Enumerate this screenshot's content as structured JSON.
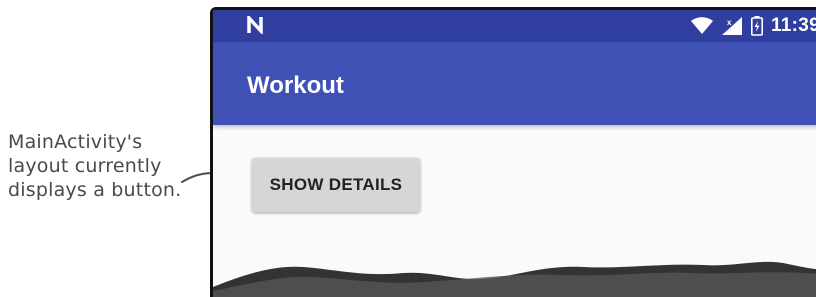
{
  "annotation": {
    "lines": [
      "MainActivity's",
      "layout currently",
      "displays a button."
    ]
  },
  "statusbar": {
    "left_icon": "n-notification-icon",
    "icons": [
      "wifi-icon",
      "cell-signal-icon",
      "battery-icon"
    ],
    "time": "11:39"
  },
  "appbar": {
    "title": "Workout"
  },
  "content": {
    "button_label": "SHOW DETAILS"
  },
  "colors": {
    "statusbar": "#303f9f",
    "appbar": "#3f51b5",
    "background": "#fafafa",
    "button": "#d6d6d6"
  }
}
